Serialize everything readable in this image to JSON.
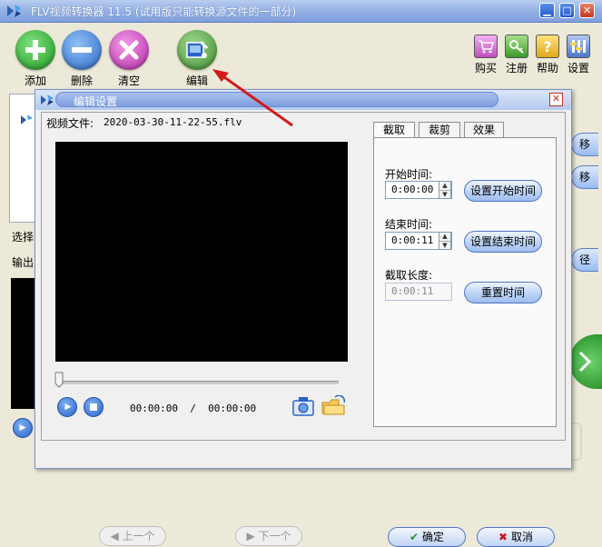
{
  "window": {
    "title": "FLV视频转换器 11.5 (试用版只能转换源文件的一部分)"
  },
  "toolbar": {
    "add_label": "添加",
    "delete_label": "删除",
    "clear_label": "清空",
    "edit_label": "编辑",
    "buy_label": "购买",
    "register_label": "注册",
    "help_label": "帮助",
    "settings_label": "设置"
  },
  "background": {
    "select_label": "选择",
    "output_label": "输出",
    "move_label_1": "移",
    "move_label_2": "移",
    "path_label": "径"
  },
  "dialog": {
    "title": "编辑设置",
    "file_label": "视频文件:",
    "file_name": "2020-03-30-11-22-55.flv",
    "time_current": "00:00:00",
    "time_separator": "/",
    "time_total": "00:00:00",
    "tabs": [
      "截取",
      "裁剪",
      "效果"
    ],
    "start_label": "开始时间:",
    "start_value": "0:00:00",
    "set_start_button": "设置开始时间",
    "end_label": "结束时间:",
    "end_value": "0:00:11",
    "set_end_button": "设置结束时间",
    "length_label": "截取长度:",
    "length_value": "0:00:11",
    "reset_button": "重置时间",
    "prev_button": "上一个",
    "next_button": "下一个",
    "ok_button": "确定",
    "cancel_button": "取消"
  },
  "colors": {
    "accent": "#2459c9",
    "arrow": "#d11a1a",
    "video_bg": "#000000"
  }
}
